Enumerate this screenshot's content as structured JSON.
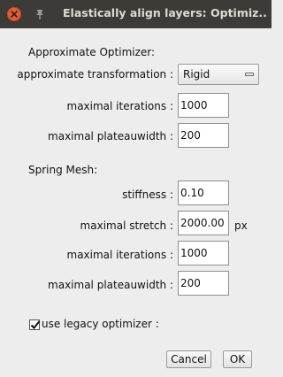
{
  "window": {
    "title": "Elastically align layers: Optimiz..."
  },
  "approximate_section": {
    "heading": "Approximate Optimizer:",
    "transformation_label": "approximate transformation :",
    "transformation_value": "Rigid",
    "iterations_label": "maximal iterations :",
    "iterations_value": "1000",
    "plateau_label": "maximal plateauwidth :",
    "plateau_value": "200"
  },
  "spring_section": {
    "heading": "Spring Mesh:",
    "stiffness_label": "stiffness :",
    "stiffness_value": "0.10",
    "stretch_label": "maximal stretch :",
    "stretch_value": "2000.00",
    "stretch_unit": "px",
    "iterations_label": "maximal iterations :",
    "iterations_value": "1000",
    "plateau_label": "maximal plateauwidth :",
    "plateau_value": "200"
  },
  "legacy": {
    "label": "use legacy optimizer :",
    "checked": true
  },
  "buttons": {
    "cancel": "Cancel",
    "ok": "OK"
  },
  "icons": {
    "close": "close-icon",
    "pin": "pin-icon",
    "dropdown": "dropdown-arrow-icon",
    "check": "checkmark-icon"
  },
  "colors": {
    "titlebar_bg": "#3c3b37",
    "close_button": "#e2603a",
    "dialog_bg": "#ededed"
  }
}
